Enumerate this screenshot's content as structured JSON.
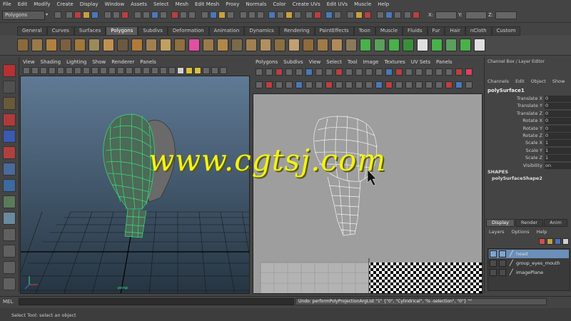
{
  "menubar": [
    "File",
    "Edit",
    "Modify",
    "Create",
    "Display",
    "Window",
    "Assets",
    "Select",
    "Mesh",
    "Edit Mesh",
    "Proxy",
    "Normals",
    "Color",
    "Create UVs",
    "Edit UVs",
    "Muscle",
    "Help"
  ],
  "status": {
    "mode": "Polygons",
    "x_label": "X:",
    "y_label": "Y:",
    "z_label": "Z:"
  },
  "shelf_tabs": [
    "General",
    "Curves",
    "Surfaces",
    "Polygons",
    "Subdivs",
    "Deformation",
    "Animation",
    "Dynamics",
    "Rendering",
    "PaintEffects",
    "Toon",
    "Muscle",
    "Fluids",
    "Fur",
    "Hair",
    "nCloth",
    "Custom"
  ],
  "shelf_active": "Polygons",
  "viewport_left": {
    "menu": [
      "View",
      "Shading",
      "Lighting",
      "Show",
      "Renderer",
      "Panels"
    ]
  },
  "viewport_right": {
    "menu": [
      "Polygons",
      "Subdivs",
      "View",
      "Select",
      "Tool",
      "Image",
      "Textures",
      "UV Sets",
      "Panels"
    ]
  },
  "channel_box": {
    "title": "Channel Box / Layer Editor",
    "menu": [
      "Channels",
      "Edit",
      "Object",
      "Show"
    ],
    "object": "polySurface1",
    "attributes": [
      {
        "name": "Translate X",
        "value": "0"
      },
      {
        "name": "Translate Y",
        "value": "0"
      },
      {
        "name": "Translate Z",
        "value": "0"
      },
      {
        "name": "Rotate X",
        "value": "0"
      },
      {
        "name": "Rotate Y",
        "value": "0"
      },
      {
        "name": "Rotate Z",
        "value": "0"
      },
      {
        "name": "Scale X",
        "value": "1"
      },
      {
        "name": "Scale Y",
        "value": "1"
      },
      {
        "name": "Scale Z",
        "value": "1"
      },
      {
        "name": "Visibility",
        "value": "on"
      }
    ],
    "shapes_header": "SHAPES",
    "shape": "polySurfaceShape2"
  },
  "layer_editor": {
    "tabs": [
      "Display",
      "Render",
      "Anim"
    ],
    "menu": [
      "Layers",
      "Options",
      "Help"
    ],
    "layers": [
      "head",
      "group_eyes_mouth",
      "imagePlane"
    ]
  },
  "command": {
    "label": "MEL",
    "result": "Undo: performPolyProjectionArgList \"1\" {\"0\", \"Cylindrical\", \"ls -selection\", \"0\"} \"\""
  },
  "helpline": "Select Tool: select an object",
  "watermark": "www.cgtsj.com",
  "colors": {
    "wire_selected": "#39e07a",
    "wire_uv": "#f4f4f4",
    "layer_selected": "#6b8fb8",
    "watermark": "#f2f21a"
  }
}
